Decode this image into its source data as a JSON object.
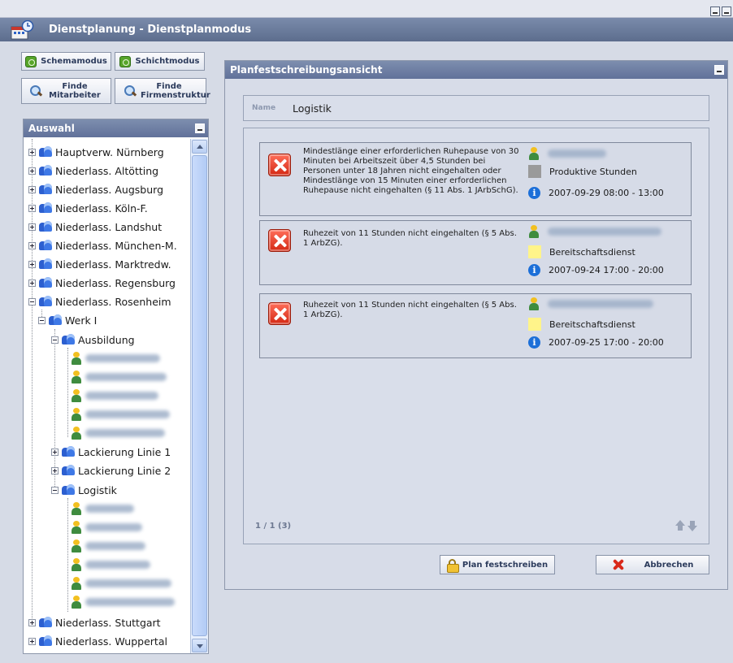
{
  "window": {
    "title": "Dienstplanung - Dienstplanmodus"
  },
  "left": {
    "buttons": {
      "schemamodus": "Schemamodus",
      "schichtmodus": "Schichtmodus",
      "finde_mitarbeiter": "Finde Mitarbeiter",
      "finde_firmenstruktur": "Finde Firmenstruktur"
    },
    "panel_title": "Auswahl",
    "tree": [
      "Hauptverw. Nürnberg",
      "Niederlass. Altötting",
      "Niederlass. Augsburg",
      "Niederlass. Köln-F.",
      "Niederlass. Landshut",
      "Niederlass. München-M.",
      "Niederlass. Marktredw.",
      "Niederlass. Regensburg",
      "Niederlass. Rosenheim",
      "Werk I",
      "Ausbildung",
      "Lackierung Linie 1",
      "Lackierung Linie 2",
      "Logistik",
      "Niederlass. Stuttgart",
      "Niederlass. Wuppertal"
    ]
  },
  "plan": {
    "title": "Planfestschreibungsansicht",
    "name_label": "Name",
    "name_value": "Logistik",
    "violations": [
      {
        "message": "Mindestlänge einer erforderlichen Ruhepause von 30 Minuten bei Arbeitszeit über 4,5 Stunden bei Personen unter 18 Jahren nicht eingehalten oder Mindestlänge von 15 Minuten einer erforderlichen Ruhepause nicht eingehalten (§ 11 Abs. 1 JArbSchG).",
        "category": "Produktive Stunden",
        "category_color": "#9a9a9a",
        "datetime": "2007-09-29 08:00 - 13:00"
      },
      {
        "message": "Ruhezeit von 11 Stunden nicht eingehalten (§ 5 Abs. 1 ArbZG).",
        "category": "Bereitschaftsdienst",
        "category_color": "#fff48a",
        "datetime": "2007-09-24 17:00 - 20:00"
      },
      {
        "message": "Ruhezeit von 11 Stunden nicht eingehalten (§ 5 Abs. 1 ArbZG).",
        "category": "Bereitschaftsdienst",
        "category_color": "#fff48a",
        "datetime": "2007-09-25 17:00 - 20:00"
      }
    ],
    "pager": "1 / 1 (3)",
    "buttons": {
      "commit": "Plan festschreiben",
      "cancel": "Abbrechen"
    }
  }
}
